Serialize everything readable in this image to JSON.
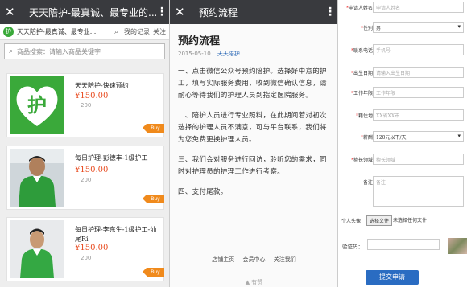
{
  "panel1": {
    "title": "天天陪护-最真诚、最专业的...",
    "site_name": "天天陪护-最真诚、最专业...",
    "nav_records": "我的记录",
    "nav_follow": "关注",
    "search_placeholder": "商品搜索：请输入商品关键字",
    "buy_label": "Buy",
    "products": [
      {
        "name": "天天陪护-快速预约",
        "price": "¥150.00",
        "sales": "200"
      },
      {
        "name": "每日护理-彭德丰-1级护工",
        "price": "¥150.00",
        "sales": "200"
      },
      {
        "name": "每日护理-李东生-1级护工-汕尾Ri",
        "price": "¥150.00",
        "sales": "200"
      }
    ],
    "logo_char": "护"
  },
  "panel2": {
    "title": "预约流程",
    "heading": "预约流程",
    "date": "2015-05-10",
    "author": "天天陪护",
    "paragraphs": [
      "一、点击微信公众号预约陪护。选择好中意的护工，填写实际服务费用，收到微信确认信息，请耐心等待我们的护理人员到指定医院服务。",
      "二、陪护人员进行专业照料，在此期间若对初次选择的护理人员不满意，可与平台联系，我们将为您免费更换护理人员。",
      "三、我们会对服务进行回访，聆听您的需求，同时对护理员的护理工作进行考察。",
      "四、支付尾款。"
    ],
    "footer": [
      "店铺主页",
      "会员中心",
      "关注我们"
    ],
    "share": "有赞"
  },
  "panel3": {
    "fields": [
      {
        "label": "申请人姓名",
        "value": "申请人姓名",
        "required": true
      },
      {
        "label": "性别",
        "value": "男",
        "required": true
      },
      {
        "label": "联系电话",
        "value": "手机号",
        "required": true
      },
      {
        "label": "出生日期",
        "value": "请输入出生日期",
        "required": true
      },
      {
        "label": "工作年限",
        "value": "工作年限",
        "required": true
      },
      {
        "label": "籍住地",
        "value": "XX省XX市",
        "required": true
      },
      {
        "label": "薪酬",
        "value": "120元以下/天",
        "required": true
      },
      {
        "label": "擅长领域",
        "value": "擅长领域",
        "required": true
      },
      {
        "label": "备注",
        "value": "备注",
        "required": false
      }
    ],
    "avatar_label": "个人头像",
    "file_button": "选择文件",
    "file_status": "未选择任何文件",
    "captcha_label": "验证码：",
    "submit_label": "提交申请"
  },
  "colors": {
    "topbar": "#393a3e",
    "price": "#e8491d",
    "buy": "#f08a1c",
    "submit": "#2a6cc2",
    "brand_green": "#3aa93a"
  }
}
